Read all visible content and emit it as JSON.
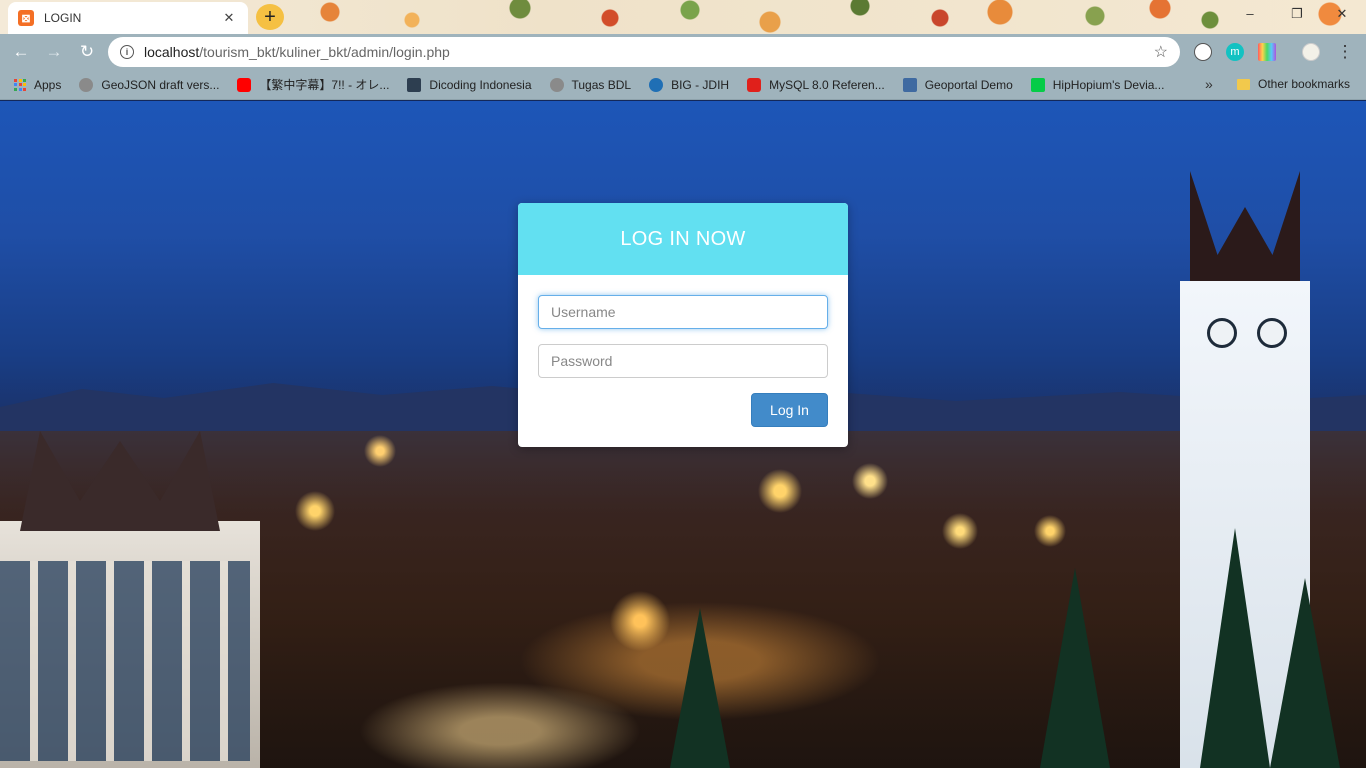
{
  "browser": {
    "tab_title": "LOGIN",
    "tab_close": "✕",
    "new_tab": "+",
    "url_host": "localhost",
    "url_path": "/tourism_bkt/kuliner_bkt/admin/login.php",
    "window_controls": {
      "minimize": "–",
      "maximize": "❐",
      "close": "✕"
    },
    "nav": {
      "back": "←",
      "forward": "→",
      "reload": "↻"
    },
    "star": "☆",
    "extensions": [
      {
        "name": "extension-1",
        "color": "#ffffff"
      },
      {
        "name": "extension-m",
        "color": "#13c2c2",
        "label": "m"
      },
      {
        "name": "extension-colors",
        "color": "#ff5c5c"
      },
      {
        "name": "profile-avatar",
        "color": "#f3f1e8"
      }
    ],
    "menu": "⋮"
  },
  "bookmarks": {
    "items": [
      {
        "label": "Apps",
        "icon": "apps-grid-icon"
      },
      {
        "label": "GeoJSON draft vers...",
        "icon": "globe-icon",
        "color": "#8a8a8a"
      },
      {
        "label": "【繁中字幕】7!! - オレ...",
        "icon": "youtube-icon",
        "color": "#ff0000"
      },
      {
        "label": "Dicoding Indonesia",
        "icon": "dicoding-icon",
        "color": "#2d3e50"
      },
      {
        "label": "Tugas BDL",
        "icon": "globe-icon",
        "color": "#8a8a8a"
      },
      {
        "label": "BIG - JDIH",
        "icon": "big-logo-icon",
        "color": "#1f6fb5"
      },
      {
        "label": "MySQL 8.0 Referen...",
        "icon": "oracle-icon",
        "color": "#e0201b"
      },
      {
        "label": "Geoportal Demo",
        "icon": "geoportal-icon",
        "color": "#3f6aa1"
      },
      {
        "label": "HipHopium's Devia...",
        "icon": "deviantart-icon",
        "color": "#05cc47"
      }
    ],
    "more": "»",
    "other": "Other bookmarks"
  },
  "login": {
    "title": "LOG IN NOW",
    "username_placeholder": "Username",
    "password_placeholder": "Password",
    "button_label": "Log In",
    "colors": {
      "header": "#62e0f1",
      "button": "#428bca"
    }
  }
}
